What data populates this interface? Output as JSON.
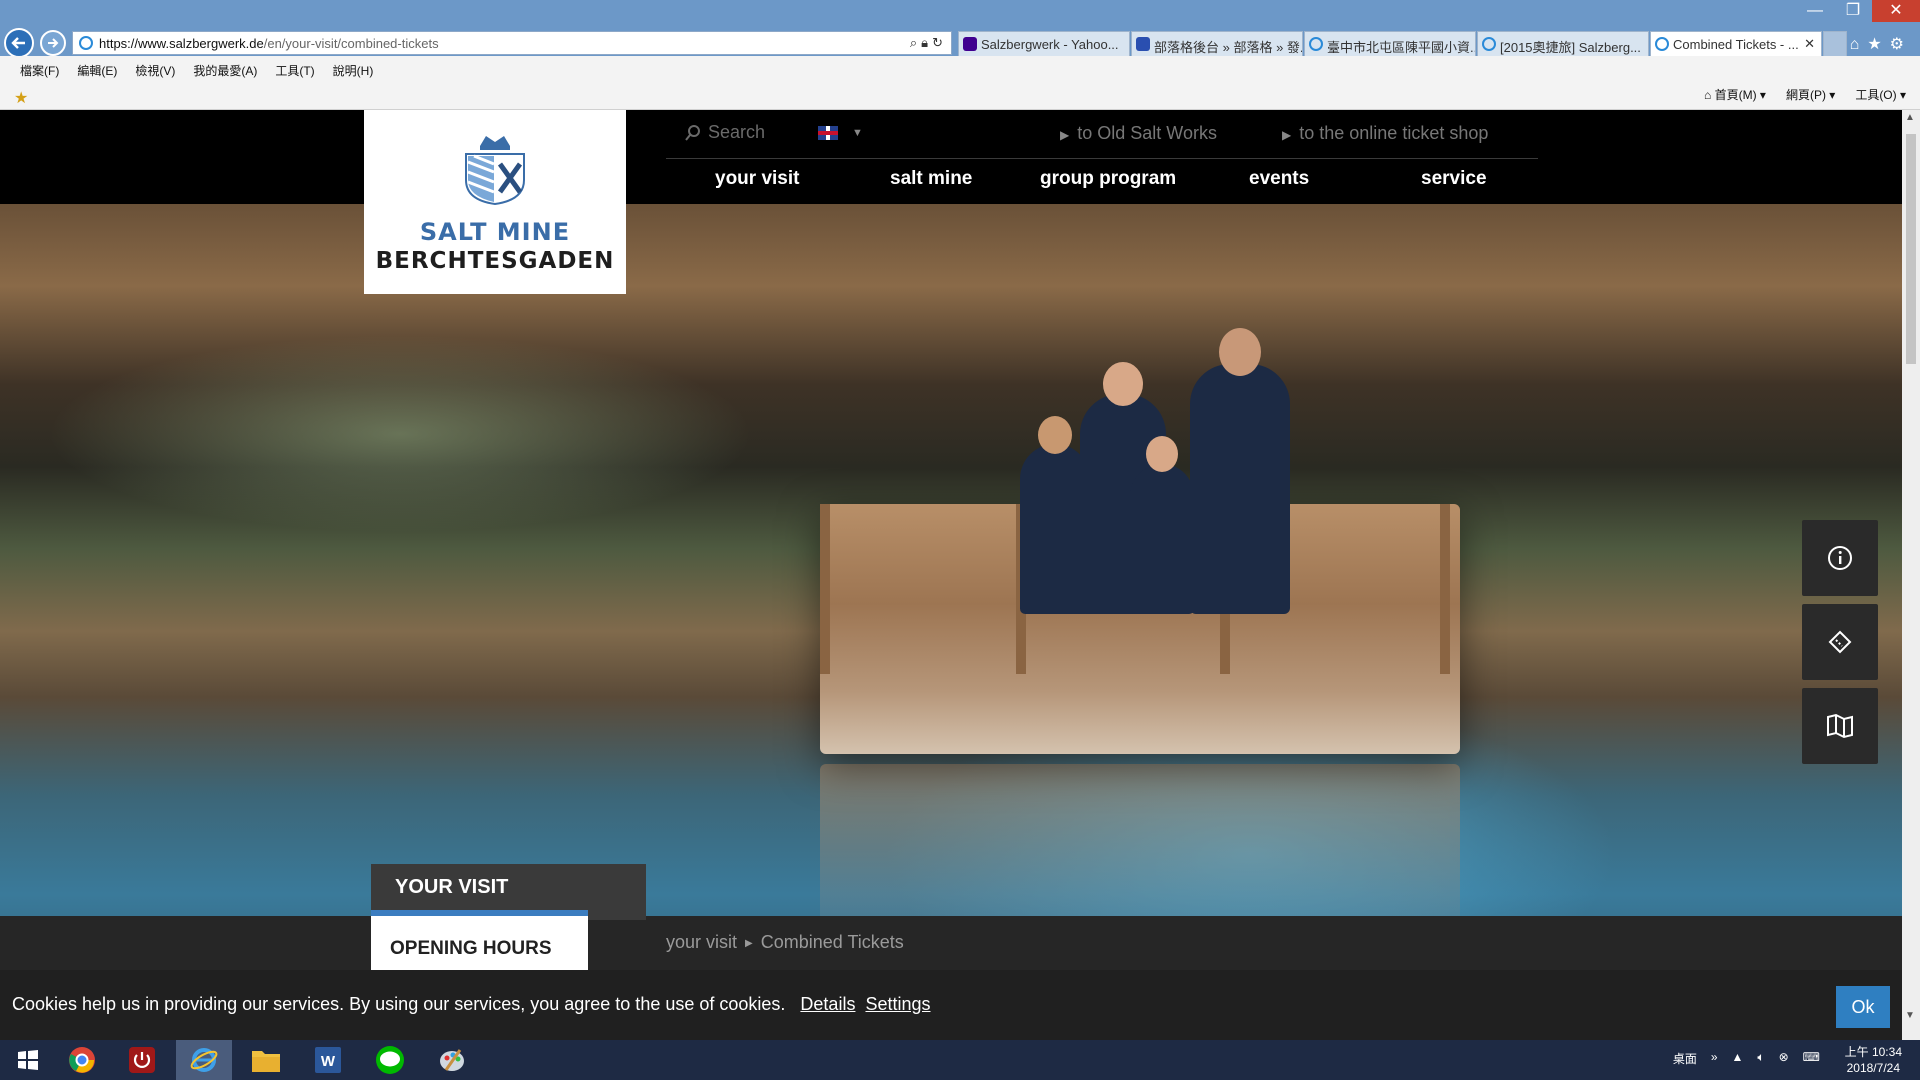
{
  "window": {
    "minimize": "—",
    "maximize": "❐",
    "close": "✕"
  },
  "address": {
    "host": "https://www.salzbergwerk.de",
    "path": "/en/your-visit/combined-tickets"
  },
  "tabs": [
    {
      "label": "Salzbergwerk - Yahoo...",
      "color": "#400090"
    },
    {
      "label": "部落格後台 » 部落格 » 發...",
      "color": "#2a4fb0"
    },
    {
      "label": "臺中市北屯區陳平國小資...",
      "color": "#2a8ad8"
    },
    {
      "label": "[2015奧捷旅] Salzberg...",
      "color": "#2a8ad8"
    },
    {
      "label": "Combined Tickets - ...",
      "color": "#2a8ad8"
    }
  ],
  "menus": [
    "檔案(F)",
    "編輯(E)",
    "檢視(V)",
    "我的最愛(A)",
    "工具(T)",
    "說明(H)"
  ],
  "commands": [
    "首頁(M)",
    "網頁(P)",
    "工具(O)"
  ],
  "site": {
    "logo": {
      "line1": "SALT MINE",
      "line2": "BERCHTESGADEN"
    },
    "search_placeholder": "Search",
    "links": {
      "old_salt_works": "to Old Salt Works",
      "ticket_shop": "to the online ticket shop"
    },
    "nav": [
      "your visit",
      "salt mine",
      "group program",
      "events",
      "service"
    ],
    "section_title": "YOUR VISIT",
    "subnav_active": "OPENING HOURS",
    "breadcrumb": [
      "your visit",
      "Combined Tickets"
    ]
  },
  "cookie": {
    "message": "Cookies help us in providing our services. By using our services, you agree to the use of cookies.",
    "details": "Details",
    "settings": "Settings",
    "ok": "Ok"
  },
  "side_buttons": [
    "info-icon",
    "ticket-icon",
    "map-icon"
  ],
  "tray": {
    "desktop": "桌面",
    "chevron": "»"
  },
  "clock": {
    "time": "上午 10:34",
    "date": "2018/7/24"
  },
  "colors": {
    "accent": "#2f7fc1",
    "logo_blue": "#3a6da8",
    "header_bg": "#000000"
  }
}
